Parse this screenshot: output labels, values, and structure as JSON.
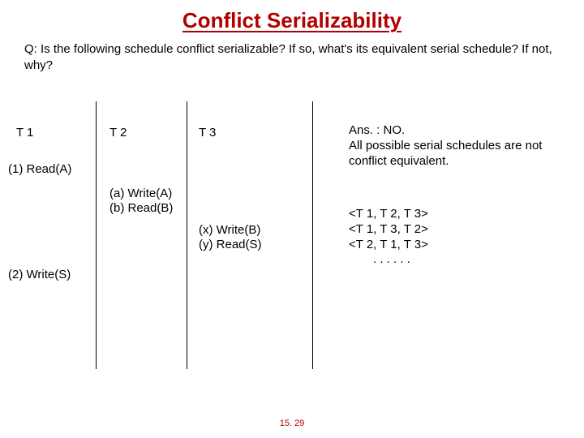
{
  "title": "Conflict Serializability",
  "question": "Q: Is the following schedule conflict serializable? If so, what's its equivalent serial schedule? If not, why?",
  "schedule": {
    "t1": {
      "label": "T 1",
      "op1": "(1) Read(A)",
      "op2": "(2) Write(S)"
    },
    "t2": {
      "label": "T 2",
      "opA": "(a) Write(A)",
      "opB": "(b) Read(B)"
    },
    "t3": {
      "label": "T 3",
      "opX": "(x) Write(B)",
      "opY": "(y) Read(S)"
    }
  },
  "answer": {
    "line1": "Ans. : NO.",
    "line2": "All possible serial schedules are not conflict equivalent."
  },
  "orders": {
    "o1": "<T 1, T 2, T 3>",
    "o2": "<T 1, T 3, T 2>",
    "o3": "<T 2, T 1, T 3>",
    "dots": ".  .  .  .  .  ."
  },
  "footer": "15. 29"
}
